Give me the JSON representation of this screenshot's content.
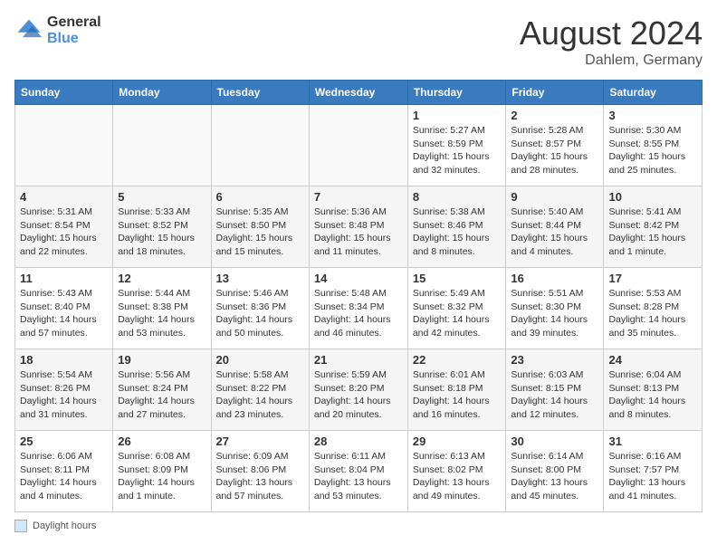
{
  "header": {
    "logo_general": "General",
    "logo_blue": "Blue",
    "month_title": "August 2024",
    "location": "Dahlem, Germany"
  },
  "weekdays": [
    "Sunday",
    "Monday",
    "Tuesday",
    "Wednesday",
    "Thursday",
    "Friday",
    "Saturday"
  ],
  "weeks": [
    [
      {
        "day": "",
        "sunrise": "",
        "sunset": "",
        "daylight": ""
      },
      {
        "day": "",
        "sunrise": "",
        "sunset": "",
        "daylight": ""
      },
      {
        "day": "",
        "sunrise": "",
        "sunset": "",
        "daylight": ""
      },
      {
        "day": "",
        "sunrise": "",
        "sunset": "",
        "daylight": ""
      },
      {
        "day": "1",
        "sunrise": "Sunrise: 5:27 AM",
        "sunset": "Sunset: 8:59 PM",
        "daylight": "Daylight: 15 hours and 32 minutes."
      },
      {
        "day": "2",
        "sunrise": "Sunrise: 5:28 AM",
        "sunset": "Sunset: 8:57 PM",
        "daylight": "Daylight: 15 hours and 28 minutes."
      },
      {
        "day": "3",
        "sunrise": "Sunrise: 5:30 AM",
        "sunset": "Sunset: 8:55 PM",
        "daylight": "Daylight: 15 hours and 25 minutes."
      }
    ],
    [
      {
        "day": "4",
        "sunrise": "Sunrise: 5:31 AM",
        "sunset": "Sunset: 8:54 PM",
        "daylight": "Daylight: 15 hours and 22 minutes."
      },
      {
        "day": "5",
        "sunrise": "Sunrise: 5:33 AM",
        "sunset": "Sunset: 8:52 PM",
        "daylight": "Daylight: 15 hours and 18 minutes."
      },
      {
        "day": "6",
        "sunrise": "Sunrise: 5:35 AM",
        "sunset": "Sunset: 8:50 PM",
        "daylight": "Daylight: 15 hours and 15 minutes."
      },
      {
        "day": "7",
        "sunrise": "Sunrise: 5:36 AM",
        "sunset": "Sunset: 8:48 PM",
        "daylight": "Daylight: 15 hours and 11 minutes."
      },
      {
        "day": "8",
        "sunrise": "Sunrise: 5:38 AM",
        "sunset": "Sunset: 8:46 PM",
        "daylight": "Daylight: 15 hours and 8 minutes."
      },
      {
        "day": "9",
        "sunrise": "Sunrise: 5:40 AM",
        "sunset": "Sunset: 8:44 PM",
        "daylight": "Daylight: 15 hours and 4 minutes."
      },
      {
        "day": "10",
        "sunrise": "Sunrise: 5:41 AM",
        "sunset": "Sunset: 8:42 PM",
        "daylight": "Daylight: 15 hours and 1 minute."
      }
    ],
    [
      {
        "day": "11",
        "sunrise": "Sunrise: 5:43 AM",
        "sunset": "Sunset: 8:40 PM",
        "daylight": "Daylight: 14 hours and 57 minutes."
      },
      {
        "day": "12",
        "sunrise": "Sunrise: 5:44 AM",
        "sunset": "Sunset: 8:38 PM",
        "daylight": "Daylight: 14 hours and 53 minutes."
      },
      {
        "day": "13",
        "sunrise": "Sunrise: 5:46 AM",
        "sunset": "Sunset: 8:36 PM",
        "daylight": "Daylight: 14 hours and 50 minutes."
      },
      {
        "day": "14",
        "sunrise": "Sunrise: 5:48 AM",
        "sunset": "Sunset: 8:34 PM",
        "daylight": "Daylight: 14 hours and 46 minutes."
      },
      {
        "day": "15",
        "sunrise": "Sunrise: 5:49 AM",
        "sunset": "Sunset: 8:32 PM",
        "daylight": "Daylight: 14 hours and 42 minutes."
      },
      {
        "day": "16",
        "sunrise": "Sunrise: 5:51 AM",
        "sunset": "Sunset: 8:30 PM",
        "daylight": "Daylight: 14 hours and 39 minutes."
      },
      {
        "day": "17",
        "sunrise": "Sunrise: 5:53 AM",
        "sunset": "Sunset: 8:28 PM",
        "daylight": "Daylight: 14 hours and 35 minutes."
      }
    ],
    [
      {
        "day": "18",
        "sunrise": "Sunrise: 5:54 AM",
        "sunset": "Sunset: 8:26 PM",
        "daylight": "Daylight: 14 hours and 31 minutes."
      },
      {
        "day": "19",
        "sunrise": "Sunrise: 5:56 AM",
        "sunset": "Sunset: 8:24 PM",
        "daylight": "Daylight: 14 hours and 27 minutes."
      },
      {
        "day": "20",
        "sunrise": "Sunrise: 5:58 AM",
        "sunset": "Sunset: 8:22 PM",
        "daylight": "Daylight: 14 hours and 23 minutes."
      },
      {
        "day": "21",
        "sunrise": "Sunrise: 5:59 AM",
        "sunset": "Sunset: 8:20 PM",
        "daylight": "Daylight: 14 hours and 20 minutes."
      },
      {
        "day": "22",
        "sunrise": "Sunrise: 6:01 AM",
        "sunset": "Sunset: 8:18 PM",
        "daylight": "Daylight: 14 hours and 16 minutes."
      },
      {
        "day": "23",
        "sunrise": "Sunrise: 6:03 AM",
        "sunset": "Sunset: 8:15 PM",
        "daylight": "Daylight: 14 hours and 12 minutes."
      },
      {
        "day": "24",
        "sunrise": "Sunrise: 6:04 AM",
        "sunset": "Sunset: 8:13 PM",
        "daylight": "Daylight: 14 hours and 8 minutes."
      }
    ],
    [
      {
        "day": "25",
        "sunrise": "Sunrise: 6:06 AM",
        "sunset": "Sunset: 8:11 PM",
        "daylight": "Daylight: 14 hours and 4 minutes."
      },
      {
        "day": "26",
        "sunrise": "Sunrise: 6:08 AM",
        "sunset": "Sunset: 8:09 PM",
        "daylight": "Daylight: 14 hours and 1 minute."
      },
      {
        "day": "27",
        "sunrise": "Sunrise: 6:09 AM",
        "sunset": "Sunset: 8:06 PM",
        "daylight": "Daylight: 13 hours and 57 minutes."
      },
      {
        "day": "28",
        "sunrise": "Sunrise: 6:11 AM",
        "sunset": "Sunset: 8:04 PM",
        "daylight": "Daylight: 13 hours and 53 minutes."
      },
      {
        "day": "29",
        "sunrise": "Sunrise: 6:13 AM",
        "sunset": "Sunset: 8:02 PM",
        "daylight": "Daylight: 13 hours and 49 minutes."
      },
      {
        "day": "30",
        "sunrise": "Sunrise: 6:14 AM",
        "sunset": "Sunset: 8:00 PM",
        "daylight": "Daylight: 13 hours and 45 minutes."
      },
      {
        "day": "31",
        "sunrise": "Sunrise: 6:16 AM",
        "sunset": "Sunset: 7:57 PM",
        "daylight": "Daylight: 13 hours and 41 minutes."
      }
    ]
  ],
  "footer": {
    "daylight_label": "Daylight hours"
  }
}
